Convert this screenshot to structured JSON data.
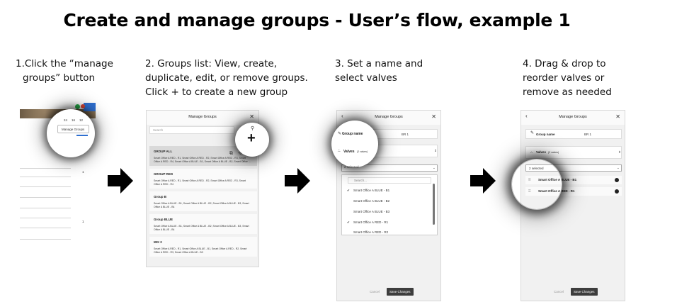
{
  "title": "Create and manage groups - User’s flow, example 1",
  "steps": [
    {
      "lines": [
        "1.Click the “manage",
        "groups” button"
      ]
    },
    {
      "lines": [
        "2. Groups list: View, create,",
        "duplicate, edit, or remove groups.",
        "Click + to create a new group"
      ]
    },
    {
      "lines": [
        "3. Set a name and",
        "select valves"
      ]
    },
    {
      "lines": [
        "4. Drag & drop to",
        "reorder valves or",
        "remove as needed"
      ]
    }
  ],
  "panel1": {
    "manage_label": "Manage Groups",
    "counter": "1",
    "small_values": [
      "24",
      "16",
      "12"
    ]
  },
  "panel2": {
    "header": "Manage Groups",
    "search_placeholder": "Search",
    "plus_icon": "plus-icon",
    "groups": [
      {
        "name": "GROUP ALL",
        "desc1": "Smart Office A RED - R1, Smart Office A RED - R2, Smart Office A RED - R3, Smart",
        "desc2": "Office A RED - R4, Smart Office A BLUE - B1, Smart Office A BLUE - B2, Smart Office ..."
      },
      {
        "name": "GROUP RED",
        "desc1": "Smart Office A RED - R1, Smart Office A RED - R2, Smart Office A RED - R3, Smart",
        "desc2": "Office A RED - R4"
      },
      {
        "name": "Group B",
        "desc1": "Smart Office A BLUE - B1, Smart Office A BLUE - B2, Smart Office A BLUE - B3, Smart",
        "desc2": "Office A BLUE - B4"
      },
      {
        "name": "Group BLUE",
        "desc1": "Smart Office A BLUE - B1, Smart Office A BLUE - B2, Smart Office A BLUE - B3, Smart",
        "desc2": "Office A BLUE - B4"
      },
      {
        "name": "MIX 2",
        "desc1": "Smart Office A RED - R1, Smart Office A BLUE - B1, Smart Office A RED - R2, Smart",
        "desc2": "Office A RED - R3, Smart Office A BLUE - B3"
      }
    ]
  },
  "panel3": {
    "header": "Manage Groups",
    "name_label": "Group name",
    "name_value": "BR 1",
    "valves_label": "Valves",
    "valves_count": "(2 valves)",
    "selected_text": "2 selected",
    "search_placeholder": "Search...",
    "options": [
      {
        "label": "Smart Office A BLUE - B1",
        "checked": "✔"
      },
      {
        "label": "Smart Office A BLUE - B2",
        "checked": ""
      },
      {
        "label": "Smart Office A BLUE - B3",
        "checked": ""
      },
      {
        "label": "Smart Office A RED - R1",
        "checked": "✔"
      },
      {
        "label": "Smart Office A RED - R2",
        "checked": ""
      }
    ],
    "cancel": "Cancel",
    "save": "Save Changes"
  },
  "panel4": {
    "header": "Manage Groups",
    "name_label": "Group name",
    "name_value": "BR 1",
    "valves_label": "Valves",
    "valves_count": "(2 valves)",
    "selected_text": "2 selected",
    "items": [
      "Smart Office A BLUE - B1",
      "Smart Office A RED - R1"
    ],
    "cancel": "Cancel",
    "save": "Save Changes"
  }
}
